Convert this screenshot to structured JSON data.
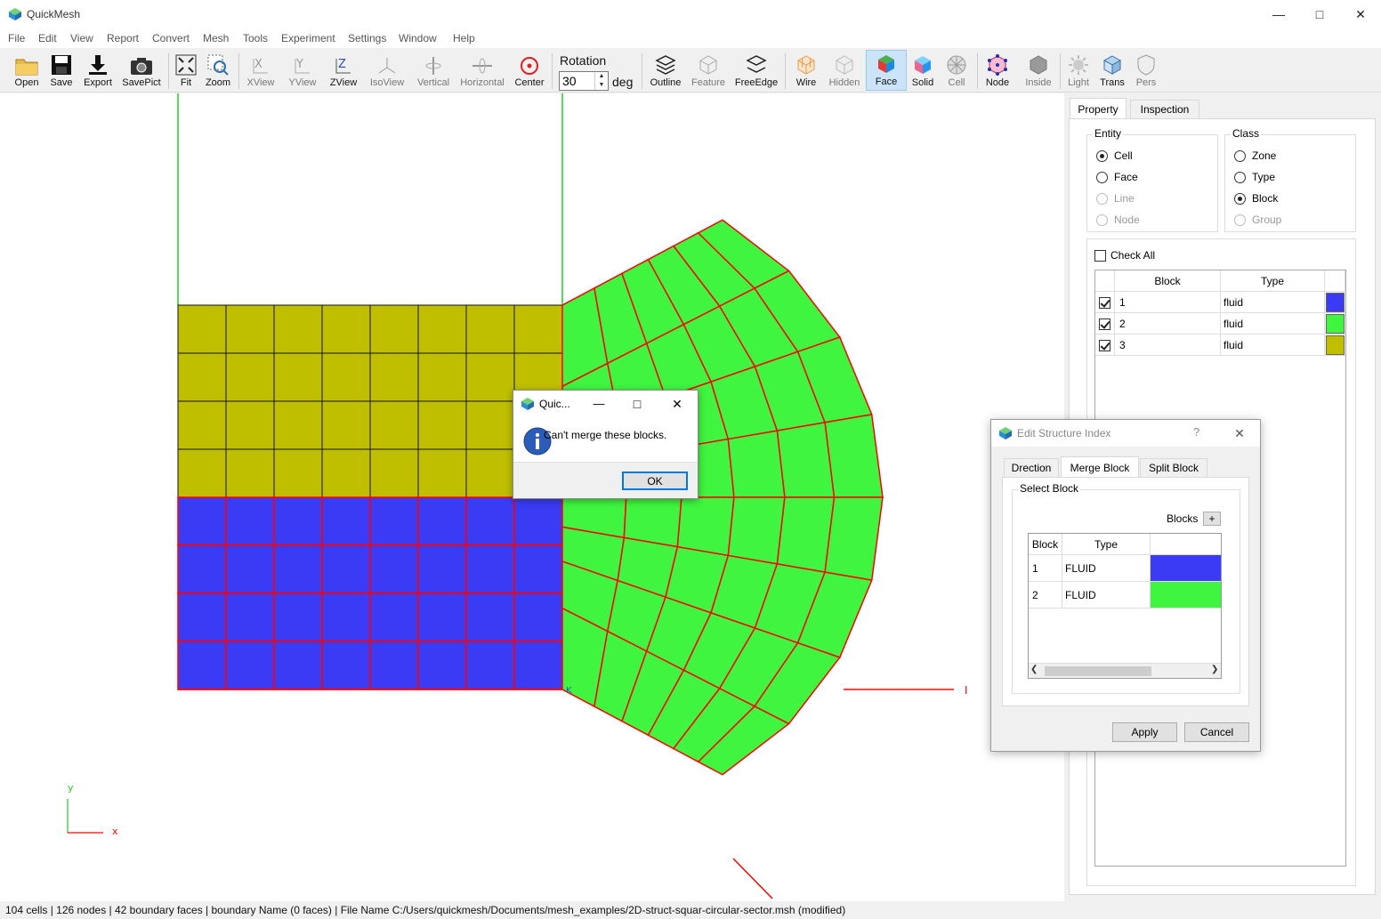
{
  "app": {
    "title": "QuickMesh"
  },
  "menu": [
    "File",
    "Edit",
    "View",
    "Report",
    "Convert",
    "Mesh",
    "Tools",
    "Experiment",
    "Settings",
    "Window",
    "Help"
  ],
  "toolbar": {
    "open": "Open",
    "save": "Save",
    "export": "Export",
    "savepict": "SavePict",
    "fit": "Fit",
    "zoom": "Zoom",
    "xview": "XView",
    "yview": "YView",
    "zview": "ZView",
    "isoview": "IsoView",
    "vertical": "Vertical",
    "horizontal": "Horizontal",
    "center": "Center",
    "rotation_label": "Rotation",
    "rotation_value": "30",
    "rotation_unit": "deg",
    "outline": "Outline",
    "feature": "Feature",
    "freeedge": "FreeEdge",
    "wire": "Wire",
    "hidden": "Hidden",
    "face": "Face",
    "solid": "Solid",
    "cell": "Cell",
    "node": "Node",
    "inside": "Inside",
    "light": "Light",
    "trans": "Trans",
    "pers": "Pers"
  },
  "viewport": {
    "axis_i": "I",
    "axis_k": "K",
    "axis_y": "y",
    "axis_x": "x",
    "colors": {
      "block1": "#3b3bf5",
      "block2": "#3ff53f",
      "block3": "#bfbf00",
      "edge": "#ff0000"
    }
  },
  "right_panel": {
    "tabs": [
      "Property",
      "Inspection"
    ],
    "entity": {
      "title": "Entity",
      "options": [
        "Cell",
        "Face",
        "Line",
        "Node"
      ],
      "selected": "Cell"
    },
    "class": {
      "title": "Class",
      "options": [
        "Zone",
        "Type",
        "Block",
        "Group"
      ],
      "selected": "Block"
    },
    "check_all": "Check All",
    "table": {
      "headers": [
        "Block",
        "Type"
      ],
      "rows": [
        {
          "block": "1",
          "type": "fluid",
          "color": "#3b3bf5",
          "checked": true
        },
        {
          "block": "2",
          "type": "fluid",
          "color": "#3ff53f",
          "checked": true
        },
        {
          "block": "3",
          "type": "fluid",
          "color": "#bfbf00",
          "checked": true
        }
      ]
    }
  },
  "message_box": {
    "title": "Quic...",
    "text": "Can't merge these blocks.",
    "ok": "OK"
  },
  "edit_dialog": {
    "title": "Edit Structure Index",
    "help": "?",
    "tabs": [
      "Drection",
      "Merge Block",
      "Split Block"
    ],
    "group_title": "Select Block",
    "blocks_label": "Blocks",
    "add": "+",
    "headers": [
      "Block",
      "Type"
    ],
    "rows": [
      {
        "block": "1",
        "type": "FLUID",
        "color": "#3b3bf5"
      },
      {
        "block": "2",
        "type": "FLUID",
        "color": "#3ff53f"
      }
    ],
    "apply": "Apply",
    "cancel": "Cancel"
  },
  "status": "104 cells | 126 nodes | 42 boundary faces |  boundary Name  (0 faces) | File Name C:/Users/quickmesh/Documents/mesh_examples/2D-struct-squar-circular-sector.msh (modified)"
}
